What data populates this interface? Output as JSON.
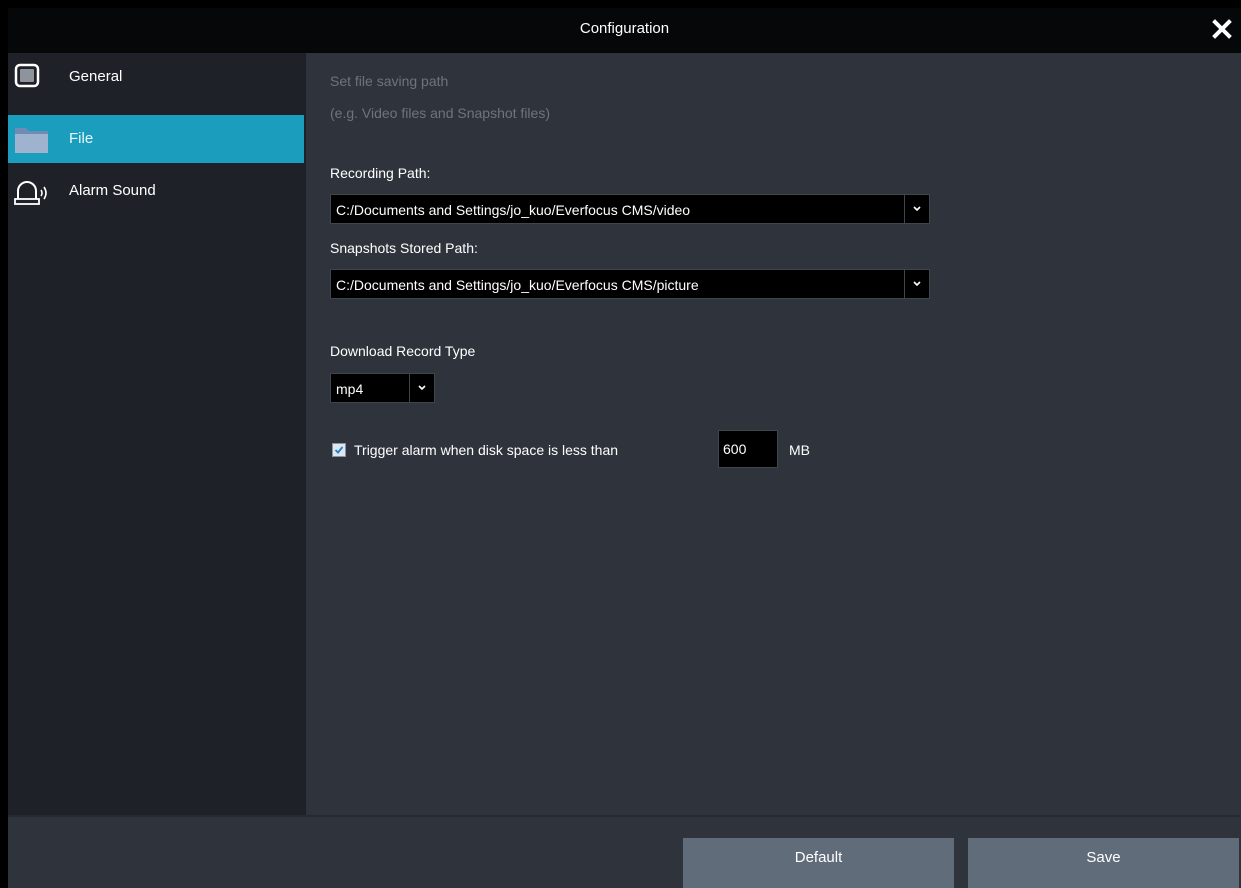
{
  "window": {
    "title": "Configuration"
  },
  "sidebar": {
    "items": [
      {
        "label": "General",
        "icon": "monitor-icon"
      },
      {
        "label": "File",
        "icon": "folder-icon",
        "active": true
      },
      {
        "label": "Alarm Sound",
        "icon": "alarm-bell-icon"
      }
    ]
  },
  "file": {
    "hint_line1": "Set file saving path",
    "hint_line2": "(e.g. Video files and Snapshot files)",
    "recording_label": "Recording Path:",
    "recording_value": "C:/Documents and Settings/jo_kuo/Everfocus CMS/video",
    "snapshot_label": "Snapshots Stored Path:",
    "snapshot_value": "C:/Documents and Settings/jo_kuo/Everfocus CMS/picture",
    "download_label": "Download Record Type",
    "download_value": "mp4",
    "trigger_checked": true,
    "trigger_label": "Trigger alarm when disk space is less than",
    "trigger_value": "600",
    "trigger_unit": "MB"
  },
  "footer": {
    "default_label": "Default",
    "save_label": "Save"
  },
  "colors": {
    "accent": "#1b9dbd",
    "button": "#616c7a",
    "panel": "#2f343c",
    "sidebar": "#1e2127"
  }
}
